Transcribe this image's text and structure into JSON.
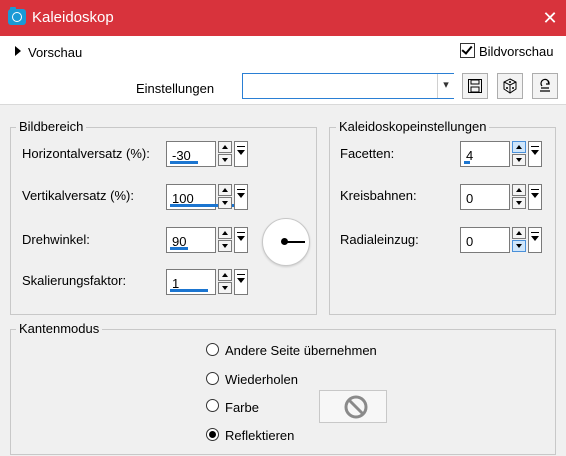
{
  "window": {
    "title": "Kaleidoskop"
  },
  "preview": {
    "toggle_label": "Vorschau",
    "checkbox_label": "Bildvorschau",
    "checked": true
  },
  "settings": {
    "label": "Einstellungen",
    "combo_value": ""
  },
  "bildbereich": {
    "title": "Bildbereich",
    "fields": [
      {
        "label": "Horizontalversatz (%):",
        "value": "-30"
      },
      {
        "label": "Vertikalversatz (%):",
        "value": "100"
      },
      {
        "label": "Drehwinkel:",
        "value": "90"
      },
      {
        "label": "Skalierungsfaktor:",
        "value": "1"
      }
    ]
  },
  "kaleido": {
    "title": "Kaleidoskopeinstellungen",
    "fields": [
      {
        "label": "Facetten:",
        "value": "4"
      },
      {
        "label": "Kreisbahnen:",
        "value": "0"
      },
      {
        "label": "Radialeinzug:",
        "value": "0"
      }
    ]
  },
  "kantenmodus": {
    "title": "Kantenmodus",
    "options": [
      {
        "label": "Andere Seite übernehmen",
        "selected": false
      },
      {
        "label": "Wiederholen",
        "selected": false
      },
      {
        "label": "Farbe",
        "selected": false
      },
      {
        "label": "Reflektieren",
        "selected": true
      }
    ]
  },
  "colors": {
    "titlebar": "#d8333c",
    "accent": "#1b75d0"
  }
}
